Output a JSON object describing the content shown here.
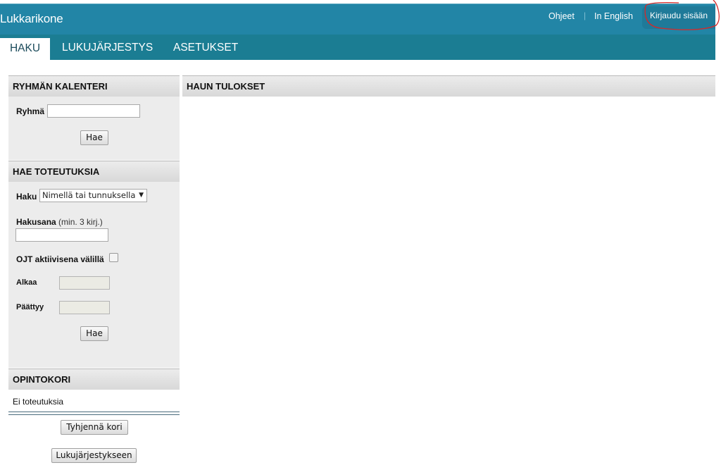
{
  "header": {
    "app_title": "Lukkarikone",
    "links": {
      "help": "Ohjeet",
      "separator": "|",
      "english": "In English"
    },
    "login_label": "Kirjaudu sisään"
  },
  "tabs": [
    {
      "label": "HAKU",
      "active": true
    },
    {
      "label": "LUKUJÄRJESTYS",
      "active": false
    },
    {
      "label": "ASETUKSET",
      "active": false
    }
  ],
  "group_calendar": {
    "title": "RYHMÄN KALENTERI",
    "group_label": "Ryhmä",
    "group_value": "",
    "search_button": "Hae"
  },
  "search_implementations": {
    "title": "HAE TOTEUTUKSIA",
    "search_label": "Haku",
    "search_mode_selected": "Nimellä tai tunnuksella",
    "keyword_label": "Hakusana",
    "keyword_hint": "(min. 3 kirj.)",
    "keyword_value": "",
    "active_between_label": "OJT aktiivisena välillä",
    "active_between_checked": false,
    "start_label": "Alkaa",
    "end_label": "Päättyy",
    "search_button": "Hae"
  },
  "study_basket": {
    "title": "OPINTOKORI",
    "empty_text": "Ei toteutuksia",
    "clear_button": "Tyhjennä kori",
    "to_timetable_button": "Lukujärjestykseen"
  },
  "results": {
    "title": "HAUN TULOKSET"
  },
  "colors": {
    "header": "#2285a6",
    "tabbar": "#1b7d93",
    "login_highlight": "#d62828"
  }
}
